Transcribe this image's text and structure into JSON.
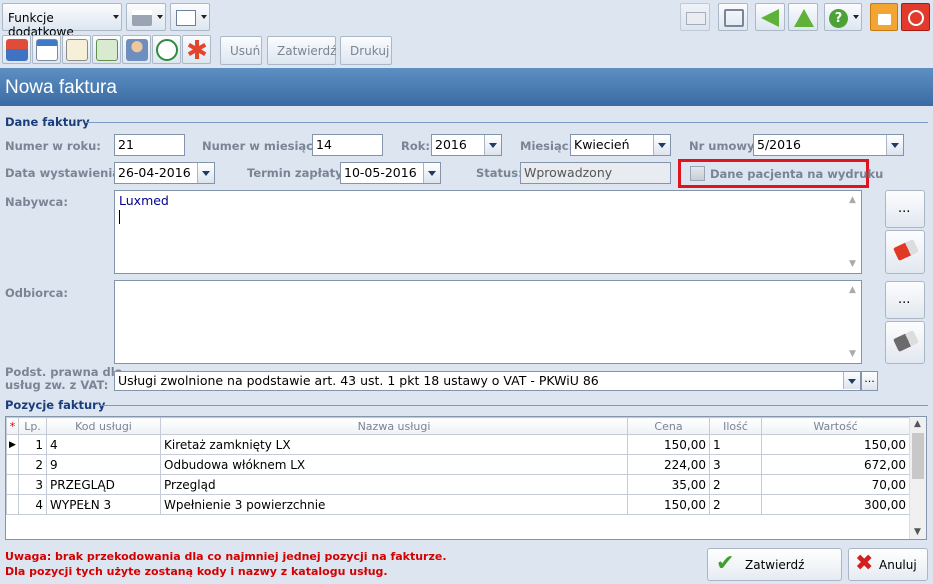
{
  "toolbar": {
    "funkcje_label": "Funkcje dodatkowe",
    "usun_label": "Usuń",
    "zatwierdz_label": "Zatwierdź",
    "drukuj_label": "Drukuj"
  },
  "page_title": "Nowa faktura",
  "dane": {
    "section_label": "Dane faktury",
    "numer_w_roku_label": "Numer w roku:",
    "numer_w_roku": "21",
    "numer_w_miesiacu_label": "Numer w miesiącu:",
    "numer_w_miesiacu": "14",
    "rok_label": "Rok:",
    "rok": "2016",
    "miesiac_label": "Miesiąc:",
    "miesiac": "Kwiecień",
    "nr_umowy_label": "Nr umowy:",
    "nr_umowy": "5/2016",
    "data_wystawienia_label": "Data wystawienia:",
    "data_wystawienia": "26-04-2016",
    "termin_label": "Termin zapłaty:",
    "termin": "10-05-2016",
    "status_label": "Status:",
    "status": "Wprowadzony",
    "dane_pacjenta_label": "Dane pacjenta na wydruku",
    "nabywca_label": "Nabywca:",
    "nabywca": "Luxmed",
    "odbiorca_label": "Odbiorca:",
    "podst_label_1": "Podst. prawna dla",
    "podst_label_2": "usług zw. z VAT:",
    "podst": "Usługi zwolnione na podstawie art. 43 ust. 1 pkt 18 ustawy o VAT - PKWiU 86",
    "side_dots": "..."
  },
  "pozycje": {
    "section_label": "Pozycje faktury",
    "columns": [
      "Lp.",
      "Kod usługi",
      "Nazwa usługi",
      "Cena",
      "Ilość",
      "Wartość"
    ],
    "rows": [
      {
        "lp": "1",
        "kod": "4",
        "nazwa": "Kiretaż zamknięty LX",
        "cena": "150,00",
        "ilosc": "1",
        "wartosc": "150,00"
      },
      {
        "lp": "2",
        "kod": "9",
        "nazwa": "Odbudowa włóknem LX",
        "cena": "224,00",
        "ilosc": "3",
        "wartosc": "672,00"
      },
      {
        "lp": "3",
        "kod": "PRZEGLĄD",
        "nazwa": "Przegląd",
        "cena": "35,00",
        "ilosc": "2",
        "wartosc": "70,00"
      },
      {
        "lp": "4",
        "kod": "WYPEŁN 3",
        "nazwa": "Wpełnienie 3 powierzchnie",
        "cena": "150,00",
        "ilosc": "2",
        "wartosc": "300,00"
      }
    ]
  },
  "footer": {
    "warn1": "Uwaga: brak przekodowania dla co najmniej jednej pozycji na fakturze.",
    "warn2": "Dla pozycji tych użyte zostaną kody i nazwy z katalogu usług.",
    "zatwierdz": "Zatwierdź",
    "anuluj": "Anuluj"
  },
  "colors": {
    "highlight": "#e0141e",
    "header": "#3a6ca4"
  }
}
